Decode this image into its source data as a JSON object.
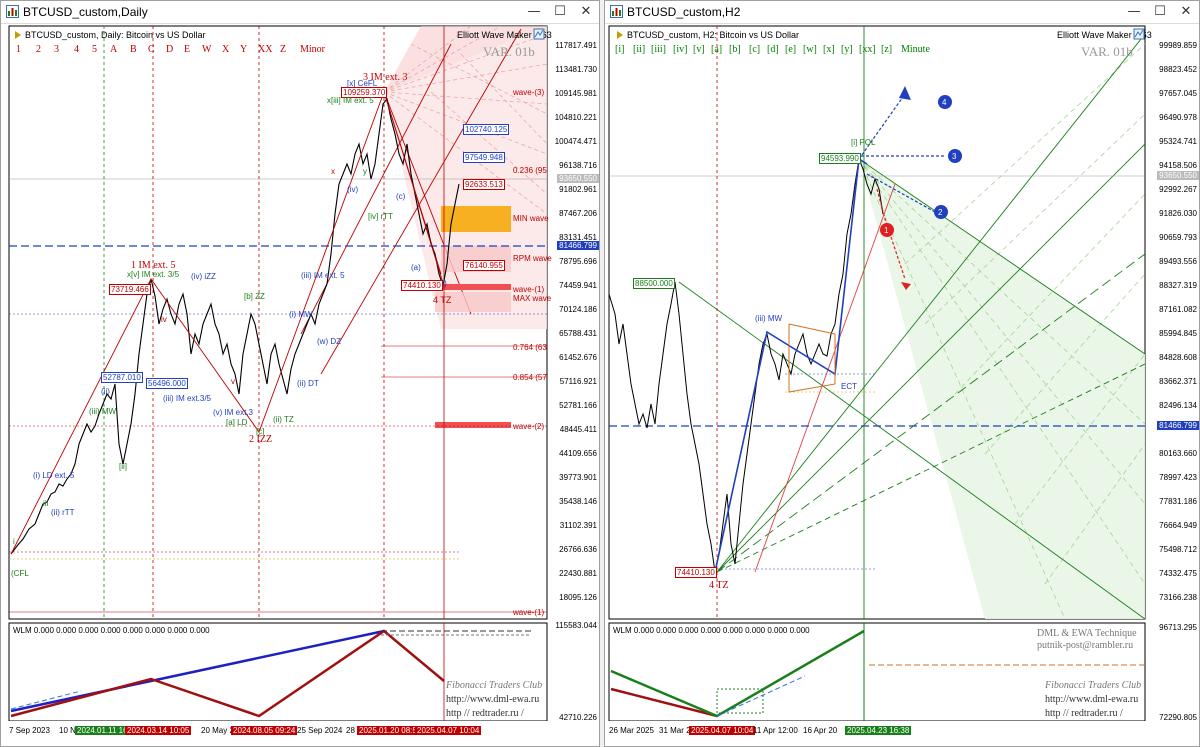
{
  "left_window": {
    "title": "BTCUSD_custom,Daily",
    "info": "BTCUSD_custom, Daily:  Bitcoin vs US Dollar",
    "plugin": "Elliott Wave Maker 5.63",
    "var_label": "VAR. 01b",
    "wave_labels_red": [
      "1",
      "2",
      "3",
      "4",
      "5",
      "A",
      "B",
      "C",
      "D",
      "E",
      "W",
      "X",
      "Y",
      "XX",
      "Z",
      "Minor"
    ],
    "price_axis": [
      "117817.491",
      "113481.730",
      "109145.981",
      "104810.221",
      "100474.471",
      "96138.716",
      "91802.961",
      "87467.206",
      "83131.451",
      "81466.799",
      "78795.696",
      "74459.941",
      "70124.186",
      "65788.431",
      "61452.676",
      "57116.921",
      "52781.166",
      "48445.411",
      "44109.656",
      "39773.901",
      "35438.146",
      "31102.391",
      "26766.636",
      "22430.881",
      "18095.126"
    ],
    "highlight_price": "81466.799",
    "grey_price": "93650.550",
    "subwindow_label": "WLM 0.000 0.000 0.000 0.000 0.000 0.000 0.000 0.000",
    "subwindow_axis": [
      "115583.044",
      "42710.226"
    ],
    "dates": [
      {
        "text": "7 Sep 2023",
        "hl": false
      },
      {
        "text": "10 No",
        "hl": false
      },
      {
        "text": "2024.01.11 16",
        "hl": true,
        "color": "#1a7f1a"
      },
      {
        "text": "2024.03.14 10:05",
        "hl": true,
        "color": "#c00000"
      },
      {
        "text": "20 May 2",
        "hl": false
      },
      {
        "text": "2024.08.05 09:24",
        "hl": true,
        "color": "#c00000"
      },
      {
        "text": "25 Sep 2024",
        "hl": false
      },
      {
        "text": "28",
        "hl": false
      },
      {
        "text": "2025.01.20 08:56",
        "hl": true,
        "color": "#c00000"
      },
      {
        "text": "2025.04.07 10:04",
        "hl": true,
        "color": "#c00000"
      }
    ],
    "annotations": {
      "wave3": "3 IM ext. 3",
      "wave1": "1 IM ext. 5",
      "wave2": "2 IZZ",
      "wave4": "4 TZ",
      "box_109": "109259.370",
      "box_73": "73719.466",
      "box_74": "74410.130",
      "box_102": "102740.125",
      "box_97": "97549.948",
      "box_92": "92633.513",
      "box_76": "76140.955",
      "box_52": "52787.010",
      "box_56": "56496.000",
      "fib_0236": "0.236 (95",
      "fib_0764": "0.764 (63",
      "fib_0854": "0.854 (57",
      "min_wave": "MIN wave",
      "rpm_wave": "RPM wave",
      "max_wave": "MAX wave",
      "wave_3": "wave-(3)",
      "wave_1": "wave-(1)",
      "wave_2": "wave-(2)",
      "wave_1b": "wave-(1)",
      "cfl": "(CFL",
      "lbl_iii_mw": "(iii) MW",
      "lbl_i_ld": "(i) LD ext. 5",
      "lbl_ii_rtt": "(ii) rTT",
      "lbl_iii_im": "(iii) IM ext.3/5",
      "lbl_v_im": "(v) IM ext.3",
      "lbl_a_ld": "[a] LD",
      "lbl_c": "[c]",
      "lbl_iii_im2": "(iii) IM ext. 5",
      "lbl_i_mw": "(i) MW",
      "lbl_w_dz": "(w) DZ",
      "lbl_ii_dt": "(ii) DT",
      "lbl_b_zz": "[b] ZZ",
      "lbl_iv_izz": "(iv) iZZ",
      "lbl_iv_rtt": "[iv] rTT",
      "lbl_x_cefl": "[x] CeFL",
      "lbl_iii_im3": "x[iii] IM ext. 5",
      "lbl_ii_tz": "(ii) TZ",
      "lbl_v_im5": "x[v] IM ext. 3/5"
    },
    "watermark": {
      "site1": "Fibonacci   Traders   Club",
      "site2": "http://www.dml-ewa.ru",
      "site3": "http  //  redtrader.ru  /"
    }
  },
  "right_window": {
    "title": "BTCUSD_custom,H2",
    "info": "BTCUSD_custom, H2:  Bitcoin vs US Dollar",
    "plugin": "Elliott Wave Maker 5.63",
    "var_label": "VAR. 01b",
    "wave_labels_green": [
      "[i]",
      "[ii]",
      "[iii]",
      "[iv]",
      "[v]",
      "[a]",
      "[b]",
      "[c]",
      "[d]",
      "[e]",
      "[w]",
      "[x]",
      "[y]",
      "[xx]",
      "[z]",
      "Minute"
    ],
    "price_axis": [
      "99989.859",
      "98823.452",
      "97657.045",
      "96490.978",
      "95324.741",
      "94158.506",
      "92992.267",
      "91826.030",
      "90659.793",
      "89493.556",
      "88327.319",
      "87161.082",
      "85994.845",
      "84828.608",
      "83662.371",
      "82496.134",
      "81466.799",
      "80163.660",
      "78997.423",
      "77831.186",
      "76664.949",
      "75498.712",
      "74332.475",
      "73166.238",
      "96713.295",
      "72290.805"
    ],
    "highlight_price": "81466.799",
    "grey_price": "93650.550",
    "subwindow_label": "WLM 0.000 0.000 0.000 0.000 0.000 0.000 0.000 0.000",
    "dates": [
      {
        "text": "26 Mar 2025",
        "hl": false
      },
      {
        "text": "31 Mar 20",
        "hl": false
      },
      {
        "text": "2025.04.07 10:04",
        "hl": true,
        "color": "#c00000"
      },
      {
        "text": "11 Apr 12:00",
        "hl": false
      },
      {
        "text": "16 Apr 20",
        "hl": false
      },
      {
        "text": "2025.04.23 16:38",
        "hl": true,
        "color": "#1a7f1a"
      }
    ],
    "annotations": {
      "box_88": "88500.000",
      "box_94": "94593.990",
      "box_74": "74410.130",
      "wave4": "4 TZ",
      "lbl_iii_mw": "(iii) MW",
      "lbl_i_pol": "[i] POL",
      "lbl_ect": "ECT",
      "pt1": "1",
      "pt2": "2",
      "pt3": "3",
      "pt4": "4"
    },
    "technique": "DML & EWA Technique",
    "email": "putnik-post@rambler.ru",
    "watermark": {
      "site1": "Fibonacci   Traders   Club",
      "site2": "http://www.dml-ewa.ru",
      "site3": "http  //  redtrader.ru  /"
    }
  }
}
